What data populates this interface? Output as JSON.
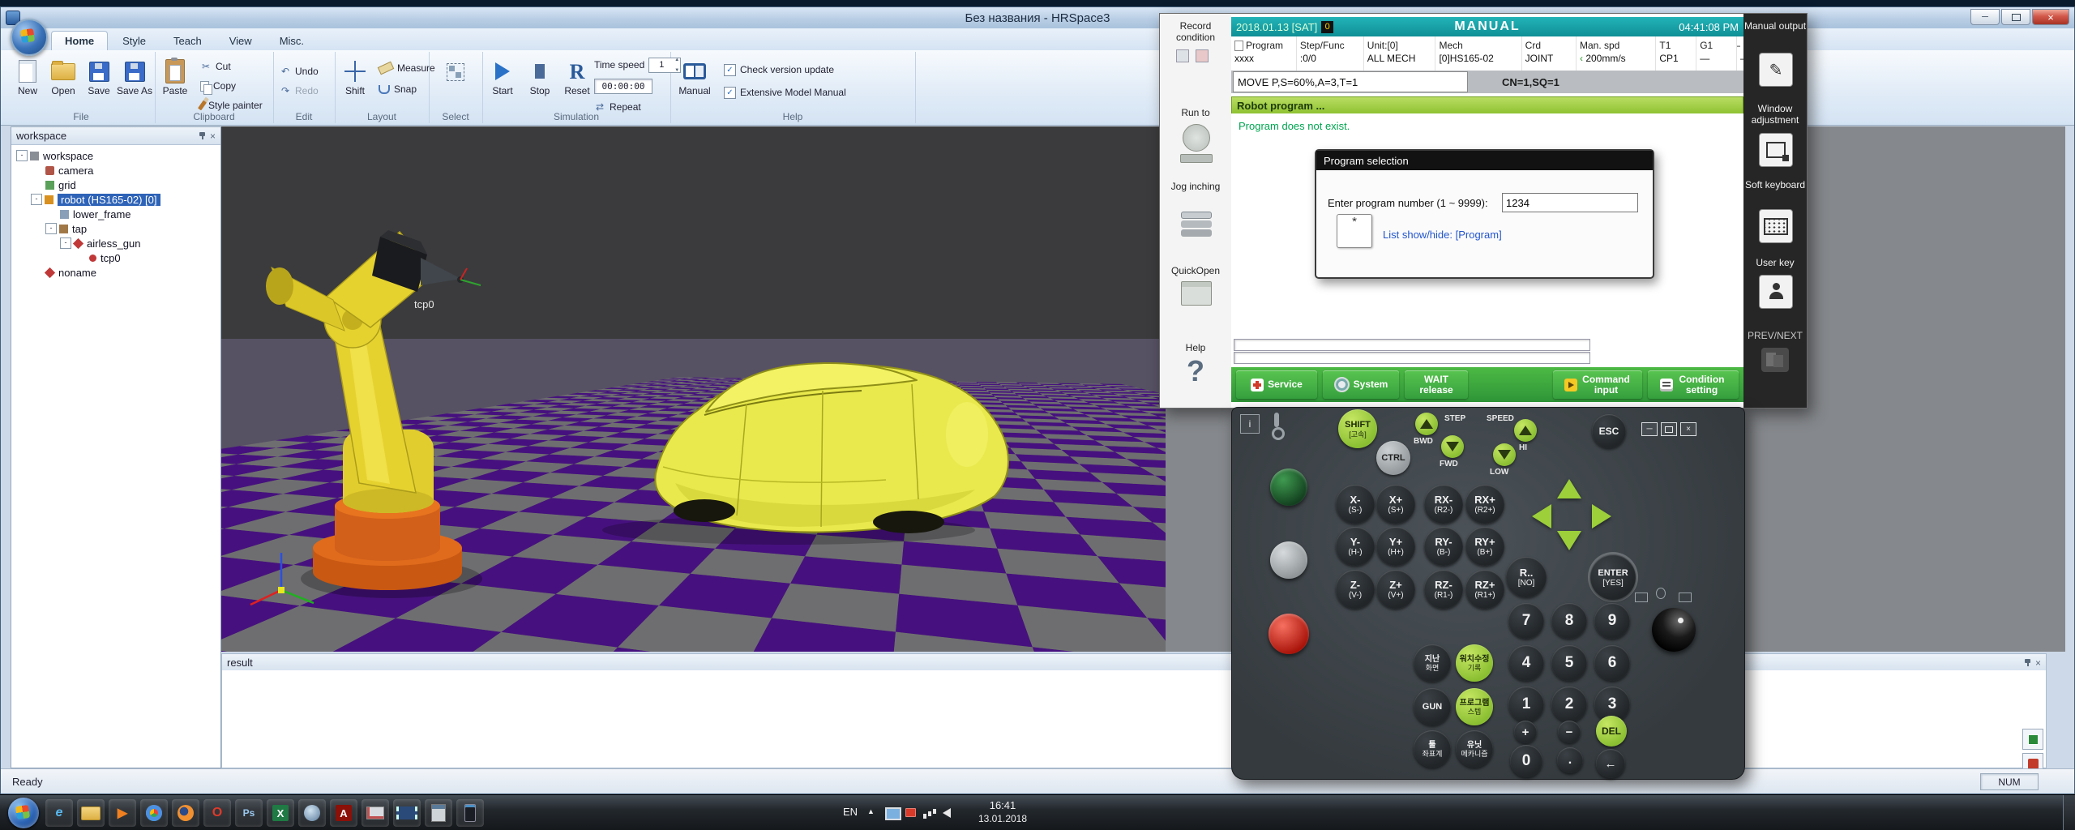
{
  "colors": {
    "accent_green": "#8fc232",
    "teal": "#12a0a8",
    "selection_blue": "#2e63b8",
    "record_red": "#e8372c",
    "purple_tile": "#46117e",
    "gray_tile": "#6e6e70",
    "robot_yellow": "#e6d22f",
    "base_orange": "#d2601a"
  },
  "icons": {
    "close": "×",
    "minimize": "─",
    "cut": "✂",
    "undo": "↶",
    "redo": "↷",
    "repeat": "⇄",
    "check": "✓",
    "question": "?",
    "back": "←",
    "caret": "▲",
    "pencil": "✎",
    "play": "▶",
    "minus_exp": "-",
    "plus_exp": "+"
  },
  "window": {
    "title": "Без названия - HRSpace3"
  },
  "ribbon": {
    "tabs": [
      {
        "label": "Home"
      },
      {
        "label": "Style"
      },
      {
        "label": "Teach"
      },
      {
        "label": "View"
      },
      {
        "label": "Misc."
      }
    ],
    "groups": {
      "file": {
        "label": "File",
        "new": "New",
        "open": "Open",
        "save": "Save",
        "save_as": "Save As"
      },
      "clipboard": {
        "label": "Clipboard",
        "paste": "Paste",
        "cut": "Cut",
        "copy": "Copy",
        "style_painter": "Style painter"
      },
      "edit": {
        "label": "Edit",
        "undo": "Undo",
        "redo": "Redo"
      },
      "layout": {
        "label": "Layout",
        "shift": "Shift",
        "measure": "Measure",
        "snap": "Snap"
      },
      "select": {
        "label": "Select"
      },
      "simulation": {
        "label": "Simulation",
        "start": "Start",
        "stop": "Stop",
        "reset": "Reset",
        "reset_glyph": "R",
        "time_speed": "Time speed",
        "speed_value": "1",
        "time": "00:00:00",
        "repeat": "Repeat"
      },
      "help": {
        "label": "Help",
        "manual": "Manual",
        "check_update": "Check version update",
        "model_manual": "Extensive Model Manual"
      }
    }
  },
  "tree": {
    "title": "workspace",
    "items": [
      {
        "label": "workspace"
      },
      {
        "label": "camera"
      },
      {
        "label": "grid"
      },
      {
        "label": "robot (HS165-02) [0]"
      },
      {
        "label": "lower_frame"
      },
      {
        "label": "tap"
      },
      {
        "label": "airless_gun"
      },
      {
        "label": "tcp0"
      },
      {
        "label": "noname"
      }
    ]
  },
  "viewport": {
    "tcp_label": "tcp0"
  },
  "result": {
    "title": "result"
  },
  "status": {
    "ready": "Ready",
    "num": "NUM"
  },
  "pendant": {
    "header": {
      "date": "2018.01.13 [SAT]",
      "badge": "0",
      "mode": "MANUAL",
      "time": "04:41:08 PM"
    },
    "menu": [
      {
        "top": "Program",
        "bottom": "xxxx"
      },
      {
        "top": "Step/Func",
        "bottom": ":0/0"
      },
      {
        "top": "Unit:[0]",
        "bottom": "ALL MECH"
      },
      {
        "top": "Mech",
        "bottom": "[0]HS165-02"
      },
      {
        "top": "Crd",
        "bottom": "JOINT"
      },
      {
        "top": "Man. spd",
        "bottom": "200mm/s"
      },
      {
        "top": "T1",
        "bottom": "CP1"
      },
      {
        "top": "G1",
        "bottom": "—"
      },
      {
        "top": "—",
        "bottom": "—"
      }
    ],
    "move_line": "MOVE P,S=60%,A=3,T=1",
    "cn_sq": "CN=1,SQ=1",
    "program_bar": "Robot program ...",
    "message": "Program does not exist.",
    "dialog": {
      "title": "Program selection",
      "prompt": "Enter program number (1 ~ 9999):",
      "value": "1234",
      "button": "*",
      "link": "List show/hide: [Program]"
    },
    "left_menu": [
      "Record condition",
      "Run to",
      "Jog inching",
      "QuickOpen",
      "Help"
    ],
    "right_menu": [
      "Manual output",
      "Window adjustment",
      "Soft keyboard",
      "User key",
      "PREV/NEXT"
    ],
    "bottom_bar": [
      "Service",
      "System",
      "WAIT release",
      "Command input",
      "Condition setting"
    ],
    "keypad": {
      "info": "i",
      "shift": {
        "l1": "SHIFT",
        "l2": "[고속]"
      },
      "ctrl": "CTRL",
      "bwd": "BWD",
      "step": "STEP",
      "fwd": "FWD",
      "speed": "SPEED",
      "hi": "HI",
      "low": "LOW",
      "esc": "ESC",
      "jog": [
        {
          "l1": "X-",
          "l2": "(S-)"
        },
        {
          "l1": "X+",
          "l2": "(S+)"
        },
        {
          "l1": "RX-",
          "l2": "(R2-)"
        },
        {
          "l1": "RX+",
          "l2": "(R2+)"
        },
        {
          "l1": "Y-",
          "l2": "(H-)"
        },
        {
          "l1": "Y+",
          "l2": "(H+)"
        },
        {
          "l1": "RY-",
          "l2": "(B-)"
        },
        {
          "l1": "RY+",
          "l2": "(B+)"
        },
        {
          "l1": "Z-",
          "l2": "(V-)"
        },
        {
          "l1": "Z+",
          "l2": "(V+)"
        },
        {
          "l1": "RZ-",
          "l2": "(R1-)"
        },
        {
          "l1": "RZ+",
          "l2": "(R1+)"
        }
      ],
      "r_no": {
        "l1": "R..",
        "l2": "[NO]"
      },
      "enter": {
        "l1": "ENTER",
        "l2": "[YES]"
      },
      "digits": [
        "7",
        "8",
        "9",
        "4",
        "5",
        "6",
        "1",
        "2",
        "3",
        "0"
      ],
      "ops": {
        "plus": "+",
        "minus": "−",
        "del": "DEL",
        "dot": ".",
        "back": "←"
      },
      "korean": [
        {
          "l1": "지난",
          "l2": "화면"
        },
        {
          "l1": "워치수정",
          "l2": "기록"
        },
        {
          "l1": "GUN",
          "l2": ""
        },
        {
          "l1": "프로그램",
          "l2": "스텝"
        },
        {
          "l1": "툴",
          "l2": "좌표계"
        },
        {
          "l1": "유닛",
          "l2": "메카니즘"
        }
      ]
    }
  },
  "taskbar": {
    "tray": {
      "lang": "EN",
      "time": "16:41",
      "date": "13.01.2018"
    },
    "apps": [
      "internet-explorer",
      "windows-explorer",
      "media-player",
      "chrome",
      "firefox",
      "opera",
      "photoshop",
      "excel",
      "media-player-2",
      "acrobat-reader",
      "paint",
      "video-editor",
      "calculator",
      "phone"
    ]
  }
}
